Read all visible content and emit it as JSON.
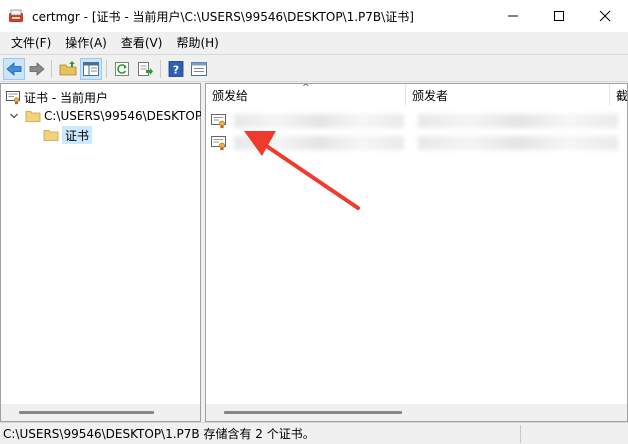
{
  "window": {
    "title": "certmgr - [证书 - 当前用户\\C:\\USERS\\99546\\DESKTOP\\1.P7B\\证书]"
  },
  "menu": [
    {
      "label": "文件(F)"
    },
    {
      "label": "操作(A)"
    },
    {
      "label": "查看(V)"
    },
    {
      "label": "帮助(H)"
    }
  ],
  "toolbar": {
    "icons": [
      "back-arrow-icon",
      "forward-arrow-icon",
      "up-folder-icon",
      "show-hide-tree-icon",
      "refresh-icon",
      "export-list-icon",
      "help-icon",
      "properties-icon"
    ]
  },
  "tree": {
    "root": "证书 - 当前用户",
    "store": "C:\\USERS\\99546\\DESKTOP\\1.P7B",
    "folder": "证书"
  },
  "list": {
    "columns": [
      "颁发给",
      "颁发者",
      "截"
    ],
    "rows": [
      {
        "issued_to": "",
        "issuer": ""
      },
      {
        "issued_to": "",
        "issuer": ""
      }
    ]
  },
  "status": {
    "text": "C:\\USERS\\99546\\DESKTOP\\1.P7B 存储含有 2 个证书。"
  },
  "colors": {
    "annotation_arrow": "#f03a2e",
    "selection": "#cce8ff",
    "back_arrow": "#3b8fd9"
  }
}
